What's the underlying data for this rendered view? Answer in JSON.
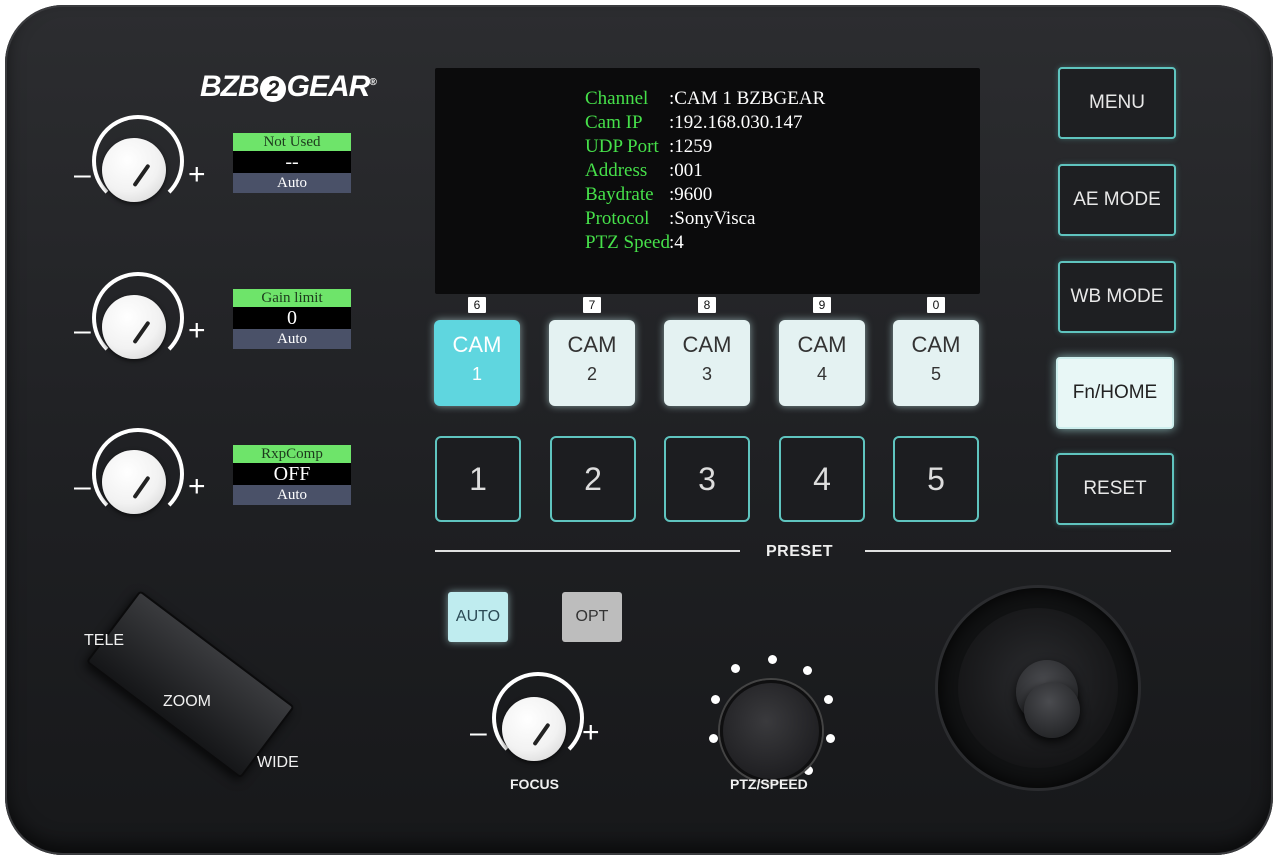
{
  "brand": {
    "logo_left": "BZB",
    "logo_mid": "2",
    "logo_right": "GEAR",
    "logo_mark": "®"
  },
  "knobs": [
    {
      "minus": "–",
      "plus": "+",
      "lcd_top": "Not Used",
      "lcd_mid": "--",
      "lcd_bot": "Auto"
    },
    {
      "minus": "–",
      "plus": "+",
      "lcd_top": "Gain limit",
      "lcd_mid": "0",
      "lcd_bot": "Auto"
    },
    {
      "minus": "–",
      "plus": "+",
      "lcd_top": "RxpComp",
      "lcd_mid": "OFF",
      "lcd_bot": "Auto"
    }
  ],
  "screen": {
    "rows": [
      {
        "key": "Channel",
        "value": ":CAM 1 BZBGEAR"
      },
      {
        "key": "Cam IP",
        "value": ":192.168.030.147"
      },
      {
        "key": "UDP Port",
        "value": ":1259"
      },
      {
        "key": "Address",
        "value": ":001"
      },
      {
        "key": "Baydrate",
        "value": ":9600"
      },
      {
        "key": "Protocol",
        "value": ":SonyVisca"
      },
      {
        "key": "PTZ Speed",
        "value": ":4"
      }
    ]
  },
  "cams": [
    {
      "tag": "6",
      "label": "CAM",
      "num": "1",
      "selected": true
    },
    {
      "tag": "7",
      "label": "CAM",
      "num": "2"
    },
    {
      "tag": "8",
      "label": "CAM",
      "num": "3"
    },
    {
      "tag": "9",
      "label": "CAM",
      "num": "4"
    },
    {
      "tag": "0",
      "label": "CAM",
      "num": "5"
    }
  ],
  "presets": [
    "1",
    "2",
    "3",
    "4",
    "5"
  ],
  "preset_label": "PRESET",
  "right_buttons": [
    "MENU",
    "AE MODE",
    "WB MODE",
    "Fn/HOME",
    "RESET"
  ],
  "focus": {
    "auto_label": "AUTO",
    "opt_label": "OPT",
    "minus": "–",
    "plus": "+",
    "label": "FOCUS"
  },
  "zoom": {
    "tele": "TELE",
    "zoom": "ZOOM",
    "wide": "WIDE"
  },
  "ptz_speed_label": "PTZ/SPEED",
  "colors": {
    "accent_teal": "#5fc4bf",
    "lcd_green": "#46e04a",
    "cam_selected": "#5fd6df"
  }
}
